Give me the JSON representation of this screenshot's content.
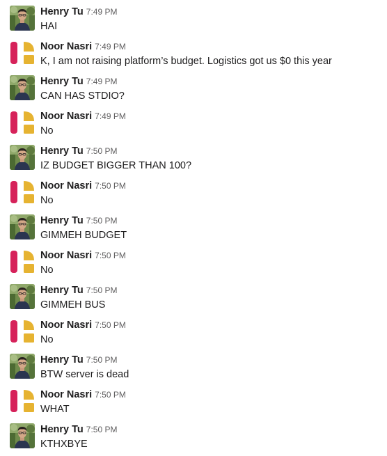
{
  "messages": [
    {
      "sender": "Henry Tu",
      "avatar": "henry-photo-avatar",
      "time": "7:49 PM",
      "text": "HAI"
    },
    {
      "sender": "Noor Nasri",
      "avatar": "noor-logo-avatar",
      "time": "7:49 PM",
      "text": "K, I am not raising platform’s budget. Logistics got us $0 this year"
    },
    {
      "sender": "Henry Tu",
      "avatar": "henry-photo-avatar",
      "time": "7:49 PM",
      "text": "CAN HAS STDIO?"
    },
    {
      "sender": "Noor Nasri",
      "avatar": "noor-logo-avatar",
      "time": "7:49 PM",
      "text": "No"
    },
    {
      "sender": "Henry Tu",
      "avatar": "henry-photo-avatar",
      "time": "7:50 PM",
      "text": "IZ BUDGET BIGGER THAN 100?"
    },
    {
      "sender": "Noor Nasri",
      "avatar": "noor-logo-avatar",
      "time": "7:50 PM",
      "text": "No"
    },
    {
      "sender": "Henry Tu",
      "avatar": "henry-photo-avatar",
      "time": "7:50 PM",
      "text": "GIMMEH BUDGET"
    },
    {
      "sender": "Noor Nasri",
      "avatar": "noor-logo-avatar",
      "time": "7:50 PM",
      "text": "No"
    },
    {
      "sender": "Henry Tu",
      "avatar": "henry-photo-avatar",
      "time": "7:50 PM",
      "text": "GIMMEH BUS"
    },
    {
      "sender": "Noor Nasri",
      "avatar": "noor-logo-avatar",
      "time": "7:50 PM",
      "text": "No"
    },
    {
      "sender": "Henry Tu",
      "avatar": "henry-photo-avatar",
      "time": "7:50 PM",
      "text": "BTW server is dead"
    },
    {
      "sender": "Noor Nasri",
      "avatar": "noor-logo-avatar",
      "time": "7:50 PM",
      "text": "WHAT"
    },
    {
      "sender": "Henry Tu",
      "avatar": "henry-photo-avatar",
      "time": "7:50 PM",
      "text": "KTHXBYE"
    }
  ],
  "colors": {
    "text": "#1d1c1d",
    "timestamp": "#616061",
    "logo_crimson": "#d6225a",
    "logo_gold": "#e6b331"
  }
}
